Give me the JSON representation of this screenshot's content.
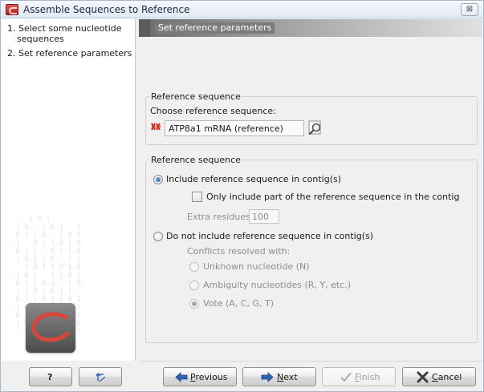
{
  "window": {
    "title": "Assemble Sequences to Reference",
    "close_label": "⊠"
  },
  "steps": {
    "items": [
      {
        "number": "1.",
        "label_line1": "Select some nucleotide",
        "label_line2": "sequences"
      },
      {
        "number": "2.",
        "label_line1": "Set reference parameters"
      }
    ]
  },
  "header": {
    "title": "Set reference parameters"
  },
  "reference_group": {
    "title": "Reference sequence",
    "choose_label": "Choose reference sequence:",
    "selected_value": "ATP8a1 mRNA (reference)",
    "sequence_icon": "dna-sequence-icon",
    "browse_icon": "browse-icon"
  },
  "options_group": {
    "title": "Reference sequence",
    "include_label": "Include reference sequence in contig(s)",
    "include_selected": true,
    "only_part_label": "Only include part of the reference sequence in the contig",
    "only_part_checked": false,
    "extra_residues_label": "Extra residues:",
    "extra_residues_value": "100",
    "exclude_label": "Do not include reference sequence in contig(s)",
    "exclude_selected": false,
    "conflicts_label": "Conflicts resolved with:",
    "conflict_options": [
      {
        "label": "Unknown nucleotide (N)",
        "selected": false
      },
      {
        "label": "Ambiguity nucleotides (R, Y, etc.)",
        "selected": false
      },
      {
        "label": "Vote (A, C, G, T)",
        "selected": true
      }
    ]
  },
  "buttons": {
    "help": "?",
    "back_icon": "reset-arrow-icon",
    "previous_prefix": "",
    "previous_underlined": "P",
    "previous_rest": "revious",
    "next_underlined": "N",
    "next_rest": "ext",
    "finish_underlined": "F",
    "finish_rest": "inish",
    "cancel_underlined": "C",
    "cancel_rest": "ancel"
  }
}
